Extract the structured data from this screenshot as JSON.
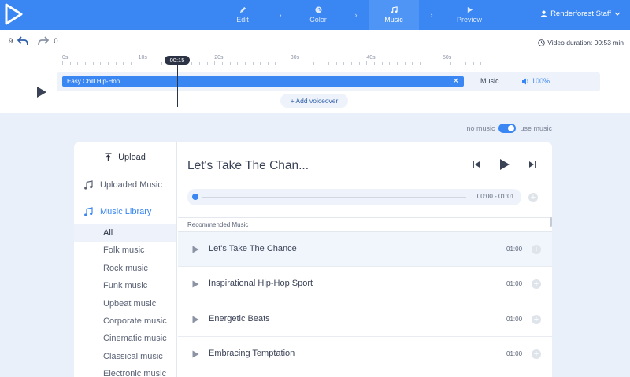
{
  "header": {
    "logo": "renderforest-play-logo",
    "steps": [
      {
        "label": "Edit",
        "icon": "pencil-icon"
      },
      {
        "label": "Color",
        "icon": "palette-icon"
      },
      {
        "label": "Music",
        "icon": "music-note-icon"
      },
      {
        "label": "Preview",
        "icon": "play-icon"
      }
    ],
    "active_step": "Music",
    "user_name": "Renderforest Staff"
  },
  "editor": {
    "undo_count": "9",
    "redo_count": "0",
    "video_duration": "Video duration: 00:53 min",
    "playhead_time": "00:15",
    "timeline_labels": [
      "0s",
      "10s",
      "20s",
      "30s",
      "40s",
      "50s"
    ],
    "track_name": "Easy Chill Hip-Hop",
    "track_type": "Music",
    "volume": "100%",
    "add_voiceover_label": "Add voiceover"
  },
  "music_toggle": {
    "off_label": "no music",
    "on_label": "use music",
    "state": "on"
  },
  "sidebar": {
    "upload_label": "Upload",
    "uploaded_label": "Uploaded Music",
    "library_label": "Music Library",
    "genres": [
      "All",
      "Folk music",
      "Rock music",
      "Funk music",
      "Upbeat music",
      "Corporate music",
      "Cinematic music",
      "Classical music",
      "Electronic music"
    ],
    "active_genre": "All"
  },
  "player": {
    "title": "Let's Take The Chan...",
    "time": "00:00 - 01:01"
  },
  "recommended": {
    "header": "Recommended Music",
    "tracks": [
      {
        "title": "Let's Take The Chance",
        "duration": "01:00"
      },
      {
        "title": "Inspirational Hip-Hop Sport",
        "duration": "01:00"
      },
      {
        "title": "Energetic Beats",
        "duration": "01:00"
      },
      {
        "title": "Embracing Temptation",
        "duration": "01:00"
      }
    ]
  },
  "colors": {
    "accent": "#3a86f2",
    "topbar": "#3a86f2",
    "background": "#eaf0fa"
  }
}
